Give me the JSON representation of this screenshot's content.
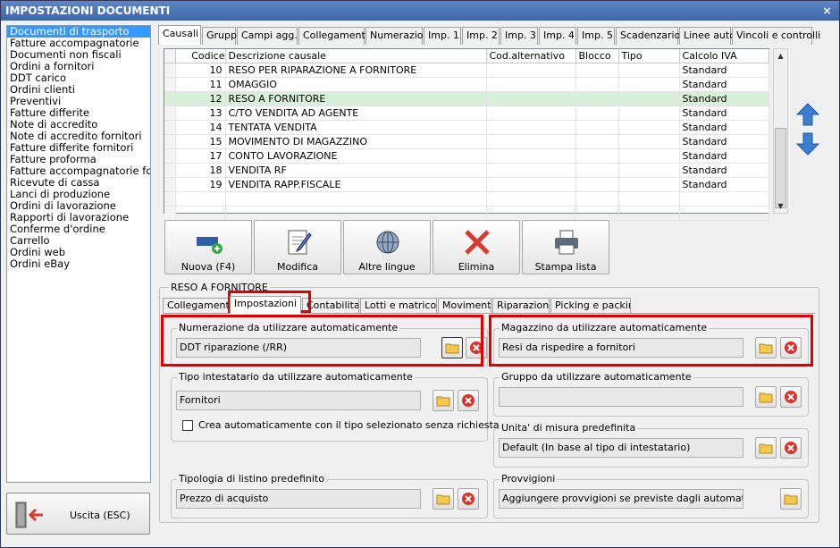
{
  "window": {
    "title": "IMPOSTAZIONI DOCUMENTI",
    "close": "×"
  },
  "doc_list": [
    "Documenti di trasporto",
    "Fatture accompagnatorie",
    "Documenti non fiscali",
    "Ordini a fornitori",
    "DDT carico",
    "Ordini clienti",
    "Preventivi",
    "Fatture differite",
    "Note di accredito",
    "Note di accredito fornitori",
    "Fatture differite fornitori",
    "Fatture proforma",
    "Fatture accompagnatorie fc",
    "Ricevute di cassa",
    "Lanci di produzione",
    "Ordini di lavorazione",
    "Rapporti di lavorazione",
    "Conferme d'ordine",
    "Carrello",
    "Ordini web",
    "Ordini eBay"
  ],
  "exit_button": {
    "label": "Uscita (ESC)"
  },
  "top_tabs": [
    "Causali",
    "Gruppi",
    "Campi agg.",
    "Collegamenti",
    "Numerazioni",
    "Imp. 1",
    "Imp. 2",
    "Imp. 3",
    "Imp. 4",
    "Imp. 5",
    "Scadenzario",
    "Linee auto",
    "Vincoli e controlli"
  ],
  "grid": {
    "columns": [
      "Codice",
      "Descrizione causale",
      "Cod.alternativo",
      "Blocco",
      "Tipo",
      "Calcolo IVA"
    ],
    "rows": [
      {
        "code": "10",
        "desc": "RESO PER RIPARAZIONE A FORNITORE",
        "alt": "",
        "blocco": "",
        "tipo": "",
        "iva": "Standard"
      },
      {
        "code": "11",
        "desc": "OMAGGIO",
        "alt": "",
        "blocco": "",
        "tipo": "",
        "iva": "Standard"
      },
      {
        "code": "12",
        "desc": "RESO A FORNITORE",
        "alt": "",
        "blocco": "",
        "tipo": "",
        "iva": "Standard"
      },
      {
        "code": "13",
        "desc": "C/TO VENDITA AD AGENTE",
        "alt": "",
        "blocco": "",
        "tipo": "",
        "iva": "Standard"
      },
      {
        "code": "14",
        "desc": "TENTATA VENDITA",
        "alt": "",
        "blocco": "",
        "tipo": "",
        "iva": "Standard"
      },
      {
        "code": "15",
        "desc": "MOVIMENTO DI MAGAZZINO",
        "alt": "",
        "blocco": "",
        "tipo": "",
        "iva": "Standard"
      },
      {
        "code": "17",
        "desc": "CONTO LAVORAZIONE",
        "alt": "",
        "blocco": "",
        "tipo": "",
        "iva": "Standard"
      },
      {
        "code": "18",
        "desc": "VENDITA RF",
        "alt": "",
        "blocco": "",
        "tipo": "",
        "iva": "Standard"
      },
      {
        "code": "19",
        "desc": "VENDITA RAPP.FISCALE",
        "alt": "",
        "blocco": "",
        "tipo": "",
        "iva": "Standard"
      }
    ],
    "selected_code": "12"
  },
  "actions": [
    {
      "label": "Nuova (F4)",
      "icon": "new-document-icon"
    },
    {
      "label": "Modifica",
      "icon": "edit-document-icon"
    },
    {
      "label": "Altre lingue",
      "icon": "globe-icon"
    },
    {
      "label": "Elimina",
      "icon": "delete-icon"
    },
    {
      "label": "Stampa lista",
      "icon": "printer-icon"
    }
  ],
  "detail": {
    "title": "RESO A FORNITORE",
    "sub_tabs": [
      "Collegamenti",
      "Impostazioni",
      "Contabilita'",
      "Lotti e matricole",
      "Movimenti",
      "Riparazioni",
      "Picking e packing"
    ],
    "active_sub_tab": "Impostazioni",
    "numerazione": {
      "label": "Numerazione da utilizzare automaticamente",
      "value": "DDT riparazione (/RR)"
    },
    "magazzino": {
      "label": "Magazzino da utilizzare automaticamente",
      "value": "Resi da rispedire a fornitori"
    },
    "tipo_intestatario": {
      "label": "Tipo intestatario da utilizzare automaticamente",
      "value": "Fornitori",
      "checkbox_label": "Crea automaticamente con il tipo selezionato senza richiesta"
    },
    "gruppo": {
      "label": "Gruppo da utilizzare automaticamente",
      "value": ""
    },
    "unita": {
      "label": "Unita' di misura predefinita",
      "value": "Default (In base al tipo di intestatario)"
    },
    "listino": {
      "label": "Tipologia di listino predefinito",
      "value": "Prezzo di acquisto"
    },
    "provvigioni": {
      "label": "Provvigioni",
      "value": "Aggiungere provvigioni se previste dagli automatismi"
    }
  },
  "colors": {
    "titlebar": "#3d66a8",
    "selection": "#3399ff",
    "grid_selected_row": "#d8f0d8",
    "highlight_frame": "#e00000",
    "arrow_blue": "#3b7fd0"
  }
}
